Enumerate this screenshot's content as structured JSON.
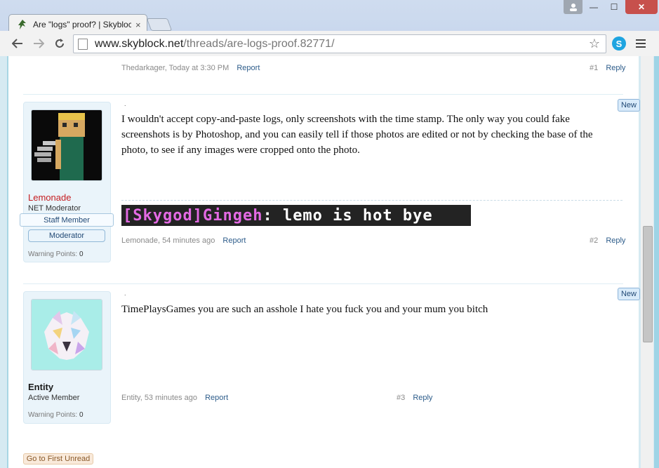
{
  "window": {
    "tab_title": "Are \"logs\" proof? | Skybloc",
    "min_label": "—",
    "max_label": "☐",
    "close_label": "✕"
  },
  "toolbar": {
    "url_domain": "www.skyblock.net",
    "url_path": "/threads/are-logs-proof.82771/"
  },
  "post1": {
    "author": "Thedarkager",
    "time": ", Today at 3:30 PM",
    "report": "Report",
    "number": "#1",
    "reply": "Reply"
  },
  "post2": {
    "new_label": "New",
    "username": "Lemonade",
    "user_title": "NET Moderator",
    "staff_badge": "Staff Member",
    "mod_badge": "Moderator",
    "warn_label": "Warning Points:",
    "warn_value": "0",
    "dot": ".",
    "text": "I wouldn't accept copy-and-paste logs, only screenshots with the time stamp. The only way you could fake screenshots is by Photoshop, and you can easily tell if those photos are edited or not by checking the base of the photo, to see if any images were cropped onto the photo.",
    "signature_rank": "[Skygod]",
    "signature_name": " Gingeh",
    "signature_msg": ": lemo is hot bye",
    "author": "Lemonade",
    "time": ", 54 minutes ago",
    "report": "Report",
    "number": "#2",
    "reply": "Reply"
  },
  "post3": {
    "new_label": "New",
    "username": "Entity",
    "user_title": "Active Member",
    "warn_label": "Warning Points:",
    "warn_value": "0",
    "dot": ".",
    "text": "TimePlaysGames you are such an asshole I hate you fuck you and your mum you bitch",
    "author": "Entity",
    "time": ", 53 minutes ago",
    "report": "Report",
    "number": "#3",
    "reply": "Reply"
  },
  "footer": {
    "first_unread": "Go to First Unread"
  },
  "colors": {
    "username_mod": "#c51d21",
    "username_member": "#1a1a1a",
    "link": "#2d5c8a"
  }
}
